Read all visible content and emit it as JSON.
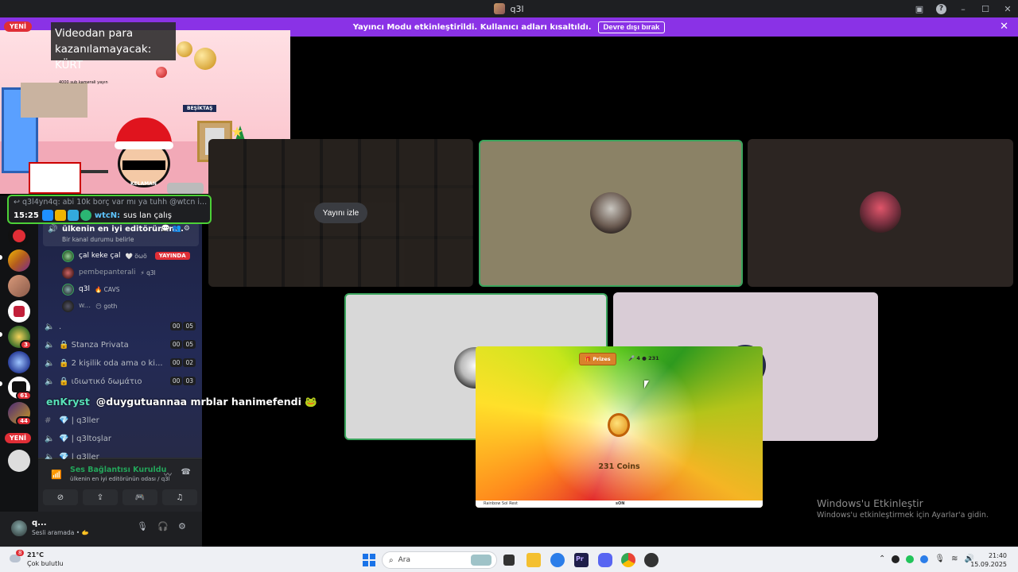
{
  "window": {
    "title": "q3l"
  },
  "notice": {
    "text": "Yayıncı Modu etkinleştirildi. Kullanıcı adları kısaltıldı.",
    "button": "Devre dışı bırak"
  },
  "badges": {
    "new_top": "YENİ",
    "new_rail": "YENİ"
  },
  "servers": [
    {
      "name": "server-1",
      "badge": ""
    },
    {
      "name": "server-2",
      "badge": ""
    },
    {
      "name": "server-3",
      "badge": ""
    },
    {
      "name": "server-4",
      "badge": ""
    },
    {
      "name": "server-5",
      "badge": "3"
    },
    {
      "name": "server-6",
      "badge": ""
    },
    {
      "name": "server-7",
      "badge": "61"
    },
    {
      "name": "server-8",
      "badge": "44"
    }
  ],
  "stream_overlay": {
    "caption": "Videodan para kazanılamayacak: KÜRT",
    "sub_label": "4000 sub kamerali yayın",
    "banner": "BEŞİKTAŞ",
    "shirt": "KELAMAN"
  },
  "chat_box": {
    "reply_line": "q3l4yn4q: abi 10k borç var mı ya tuhh @wtcn i...",
    "time": "15:25",
    "author": "wtcN:",
    "message": "sus lan çalış"
  },
  "voice_channel": {
    "name": "ülkenin en iyi editörünün...",
    "status": "Bir kanal durumu belirle",
    "members": [
      {
        "name": "çal keke çal",
        "tag": "🤍 öωö",
        "live": "YAYINDA"
      },
      {
        "name": "pembepanterali",
        "tag": "⚡ q3l",
        "live": ""
      },
      {
        "name": "q3l",
        "tag": "🔥 CAVS",
        "live": ""
      },
      {
        "name": "w...",
        "tag": "😶 goth",
        "live": ""
      }
    ]
  },
  "channels": [
    {
      "name": ".",
      "type": "voice",
      "count_a": "00",
      "count_b": "05"
    },
    {
      "name": "🔒 Stanza Privata",
      "type": "voice",
      "count_a": "00",
      "count_b": "05"
    },
    {
      "name": "🔒 2 kişilik oda ama o ki...",
      "type": "voice",
      "count_a": "00",
      "count_b": "02"
    },
    {
      "name": "🔒 ιδιωτικό δωμάτιο",
      "type": "voice",
      "count_a": "00",
      "count_b": "03"
    },
    {
      "name": "💎 | q3ller",
      "type": "text",
      "count_a": "",
      "count_b": ""
    },
    {
      "name": "💎 | q3ltoşlar",
      "type": "voice",
      "count_a": "",
      "count_b": ""
    },
    {
      "name": "💎 | q3ller",
      "type": "voice",
      "count_a": "",
      "count_b": ""
    }
  ],
  "overlay_chat": {
    "nick": "enKryst",
    "message": "@duygutuannaa mrblar hanimefendi 🐸"
  },
  "voice_panel": {
    "title": "Ses Bağlantısı Kuruldu",
    "subtitle": "ülkenin en iyi editörünün odası / q3l"
  },
  "user_panel": {
    "name": "q...",
    "status": "Sesli aramada • 🫱"
  },
  "tiles": {
    "watch_button": "Yayını izle"
  },
  "game": {
    "prizes": "Prizes",
    "stats": "🎤 4  ● 231",
    "coins": "231 Coins",
    "footer_left": "Rainbow Sol Rest",
    "footer_center": "sON"
  },
  "activation": {
    "line1": "Windows'u Etkinleştir",
    "line2": "Windows'u etkinleştirmek için Ayarlar'a gidin."
  },
  "taskbar": {
    "weather_temp": "21°C",
    "weather_desc": "Çok bulutlu",
    "weather_badge": "8",
    "search_placeholder": "Ara",
    "time": "21:40",
    "date": "15.09.2025"
  }
}
